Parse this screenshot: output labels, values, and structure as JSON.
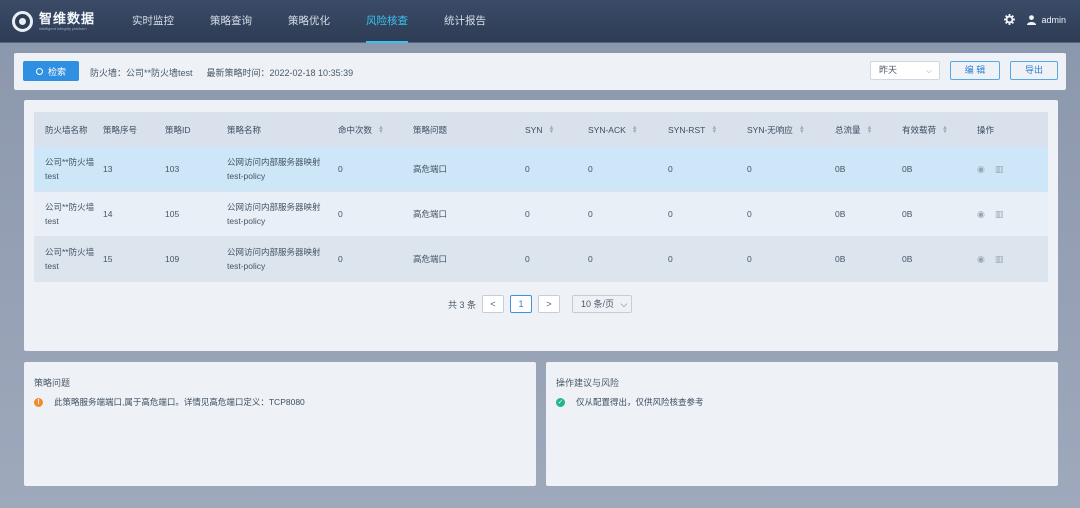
{
  "brand": {
    "name": "智维数据",
    "tagline": "intelligent integrity platform"
  },
  "nav": {
    "items": [
      "实时监控",
      "策略查询",
      "策略优化",
      "风险核查",
      "统计报告"
    ],
    "active_index": 3,
    "user": "admin"
  },
  "toolbar": {
    "search_label": "检索",
    "firewall_text": "防火墙：公司**防火墙test",
    "time_text": "最新策略时间：2022-02-18 10:35:39",
    "date_value": "昨天",
    "edit_label": "编 辑",
    "export_label": "导出"
  },
  "table": {
    "columns": [
      "防火墙名称",
      "策略序号",
      "策略ID",
      "策略名称",
      "命中次数",
      "策略问题",
      "SYN",
      "SYN-ACK",
      "SYN-RST",
      "SYN-无响应",
      "总流量",
      "有效载荷",
      "操作"
    ],
    "sortable": [
      false,
      false,
      false,
      false,
      true,
      false,
      true,
      true,
      true,
      true,
      true,
      true,
      false
    ],
    "rows": [
      [
        "公司**防火墙test",
        "13",
        "103",
        "公网访问内部服务器映射test-policy",
        "0",
        "高危端口",
        "0",
        "0",
        "0",
        "0",
        "0B",
        "0B"
      ],
      [
        "公司**防火墙test",
        "14",
        "105",
        "公网访问内部服务器映射test-policy",
        "0",
        "高危端口",
        "0",
        "0",
        "0",
        "0",
        "0B",
        "0B"
      ],
      [
        "公司**防火墙test",
        "15",
        "109",
        "公网访问内部服务器映射test-policy",
        "0",
        "高危端口",
        "0",
        "0",
        "0",
        "0",
        "0B",
        "0B"
      ]
    ],
    "selected_row": 0
  },
  "pager": {
    "total_text": "共 3 条",
    "prev": "<",
    "current": "1",
    "next": ">",
    "page_size": "10 条/页"
  },
  "issue": {
    "title": "策略问题",
    "text": "此策略服务端端口,属于高危端口。详情见高危端口定义：TCP8080"
  },
  "advice": {
    "title": "操作建议与风险",
    "text": "仅从配置得出，仅供风险核查参考"
  },
  "colors": {
    "accent": "#38c3ec",
    "primary": "#2f8fe0",
    "warn": "#f08c2e",
    "ok": "#21b58f"
  }
}
